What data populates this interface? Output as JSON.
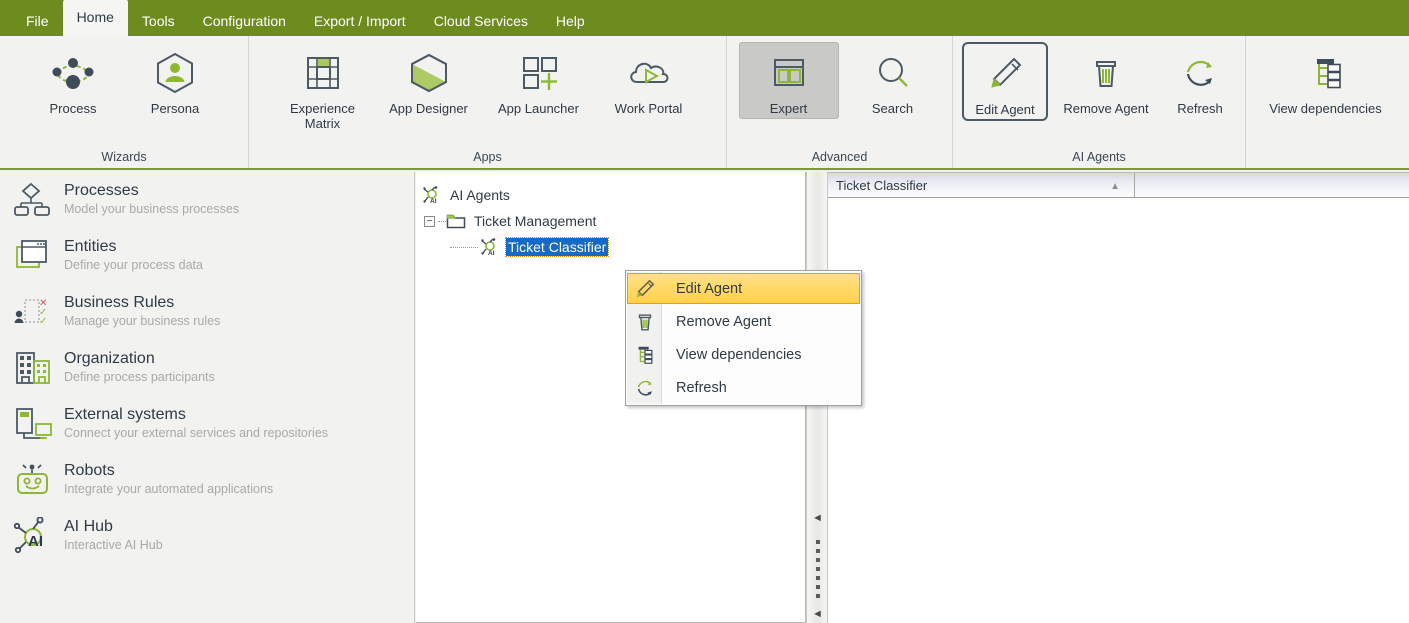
{
  "menubar": {
    "tabs": [
      {
        "label": "File",
        "active": false
      },
      {
        "label": "Home",
        "active": true
      },
      {
        "label": "Tools",
        "active": false
      },
      {
        "label": "Configuration",
        "active": false
      },
      {
        "label": "Export / Import",
        "active": false
      },
      {
        "label": "Cloud Services",
        "active": false
      },
      {
        "label": "Help",
        "active": false
      }
    ]
  },
  "ribbon": {
    "groups": [
      {
        "label": "Wizards",
        "items": [
          {
            "caption": "Process",
            "icon": "process-network-icon",
            "state": "normal"
          },
          {
            "caption": "Persona",
            "icon": "persona-hexagon-icon",
            "state": "normal"
          }
        ]
      },
      {
        "label": "Apps",
        "items": [
          {
            "caption": "Experience\nMatrix",
            "icon": "experience-matrix-icon",
            "state": "normal"
          },
          {
            "caption": "App Designer",
            "icon": "app-designer-hexagon-icon",
            "state": "normal"
          },
          {
            "caption": "App Launcher",
            "icon": "app-launcher-grid-plus-icon",
            "state": "normal"
          },
          {
            "caption": "Work Portal",
            "icon": "work-portal-cloud-play-icon",
            "state": "normal"
          }
        ]
      },
      {
        "label": "Advanced",
        "items": [
          {
            "caption": "Expert",
            "icon": "expert-window-icon",
            "state": "selected"
          },
          {
            "caption": "Search",
            "icon": "search-magnifier-icon",
            "state": "normal"
          }
        ]
      },
      {
        "label": "AI Agents",
        "items": [
          {
            "caption": "Edit Agent",
            "icon": "pencil-edit-icon",
            "state": "outlined"
          },
          {
            "caption": "Remove Agent",
            "icon": "trash-can-icon",
            "state": "normal"
          },
          {
            "caption": "Refresh",
            "icon": "refresh-circular-arrow-icon",
            "state": "normal"
          }
        ]
      },
      {
        "label": "",
        "items": [
          {
            "caption": "View dependencies",
            "icon": "dependency-tree-icon",
            "state": "normal"
          }
        ]
      }
    ]
  },
  "sidebar": {
    "items": [
      {
        "title": "Processes",
        "subtitle": "Model your business processes",
        "icon": "process-diagram-icon"
      },
      {
        "title": "Entities",
        "subtitle": "Define your process data",
        "icon": "entities-windows-icon"
      },
      {
        "title": "Business  Rules",
        "subtitle": "Manage your business rules",
        "icon": "business-rules-icon"
      },
      {
        "title": "Organization",
        "subtitle": "Define process participants",
        "icon": "organization-buildings-icon"
      },
      {
        "title": "External systems",
        "subtitle": "Connect your external services and repositories",
        "icon": "external-systems-icon"
      },
      {
        "title": "Robots",
        "subtitle": "Integrate your automated applications",
        "icon": "robot-icon"
      },
      {
        "title": "AI Hub",
        "subtitle": "Interactive AI Hub",
        "icon": "ai-hub-icon"
      }
    ]
  },
  "tree": {
    "root": {
      "label": "AI Agents",
      "icon": "ai-agents-node-icon"
    },
    "folder": {
      "label": "Ticket Management",
      "icon": "folder-icon",
      "expander": "−"
    },
    "agent": {
      "label": "Ticket Classifier",
      "icon": "ai-agent-node-icon",
      "selected": true
    }
  },
  "context_menu": {
    "items": [
      {
        "label": "Edit Agent",
        "icon": "pencil-edit-icon",
        "highlighted": true
      },
      {
        "label": "Remove Agent",
        "icon": "trash-can-icon",
        "highlighted": false
      },
      {
        "label": "View dependencies",
        "icon": "dependency-tree-icon",
        "highlighted": false
      },
      {
        "label": "Refresh",
        "icon": "refresh-circular-arrow-icon",
        "highlighted": false
      }
    ]
  },
  "grid": {
    "columns": [
      {
        "label": "Ticket Classifier",
        "sort": "ascending",
        "sort_glyph": "▲"
      },
      {
        "label": ""
      }
    ]
  },
  "splitter": {
    "collapse_glyph": "◄"
  },
  "colors": {
    "ribbon_green": "#6e8b1e",
    "accent_green": "#8cb832",
    "dark_slate": "#3d4d5c",
    "selection_blue": "#1569c7",
    "menu_highlight": "#ffd14a"
  }
}
